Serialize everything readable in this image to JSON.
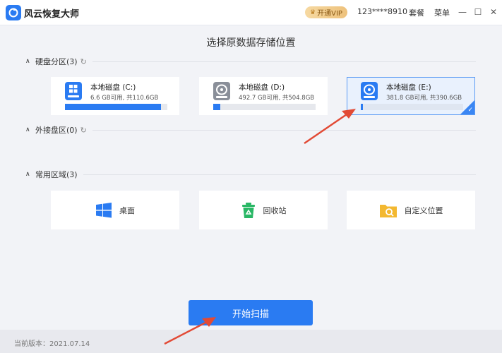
{
  "titlebar": {
    "app_title": "风云恢复大师",
    "vip_label": "开通VIP",
    "account": "123****8910",
    "help_label": "套餐",
    "menu_label": "菜单",
    "minimize": "—",
    "maximize": "☐",
    "close": "✕"
  },
  "heading": "选择原数据存储位置",
  "sections": {
    "partitions": {
      "label": "硬盘分区(3)",
      "caret": "∧",
      "refresh": "↻"
    },
    "external": {
      "label": "外接盘区(0)",
      "caret": "∧",
      "refresh": "↻"
    },
    "common": {
      "label": "常用区域(3)",
      "caret": "∧"
    }
  },
  "disks": [
    {
      "name": "本地磁盘 (C:)",
      "capacity": "6.6 GB可用, 共110.6GB",
      "used_fraction": 0.94,
      "icon": "hard-drive-windows-icon",
      "selected": false
    },
    {
      "name": "本地磁盘 (D:)",
      "capacity": "492.7 GB可用, 共504.8GB",
      "used_fraction": 0.07,
      "icon": "hard-drive-icon",
      "selected": false
    },
    {
      "name": "本地磁盘 (E:)",
      "capacity": "381.8 GB可用, 共390.6GB",
      "used_fraction": 0.02,
      "icon": "hard-drive-icon",
      "selected": true
    }
  ],
  "places": [
    {
      "label": "桌面",
      "icon": "windows-desktop-icon"
    },
    {
      "label": "回收站",
      "icon": "recycle-bin-icon"
    },
    {
      "label": "自定义位置",
      "icon": "folder-search-icon"
    }
  ],
  "scan_button": "开始扫描",
  "footer": {
    "version": "当前版本：2021.07.14"
  },
  "colors": {
    "accent": "#2a7bf2",
    "annotation": "#e24a35",
    "recycle": "#29b765",
    "folder": "#f3b830"
  }
}
